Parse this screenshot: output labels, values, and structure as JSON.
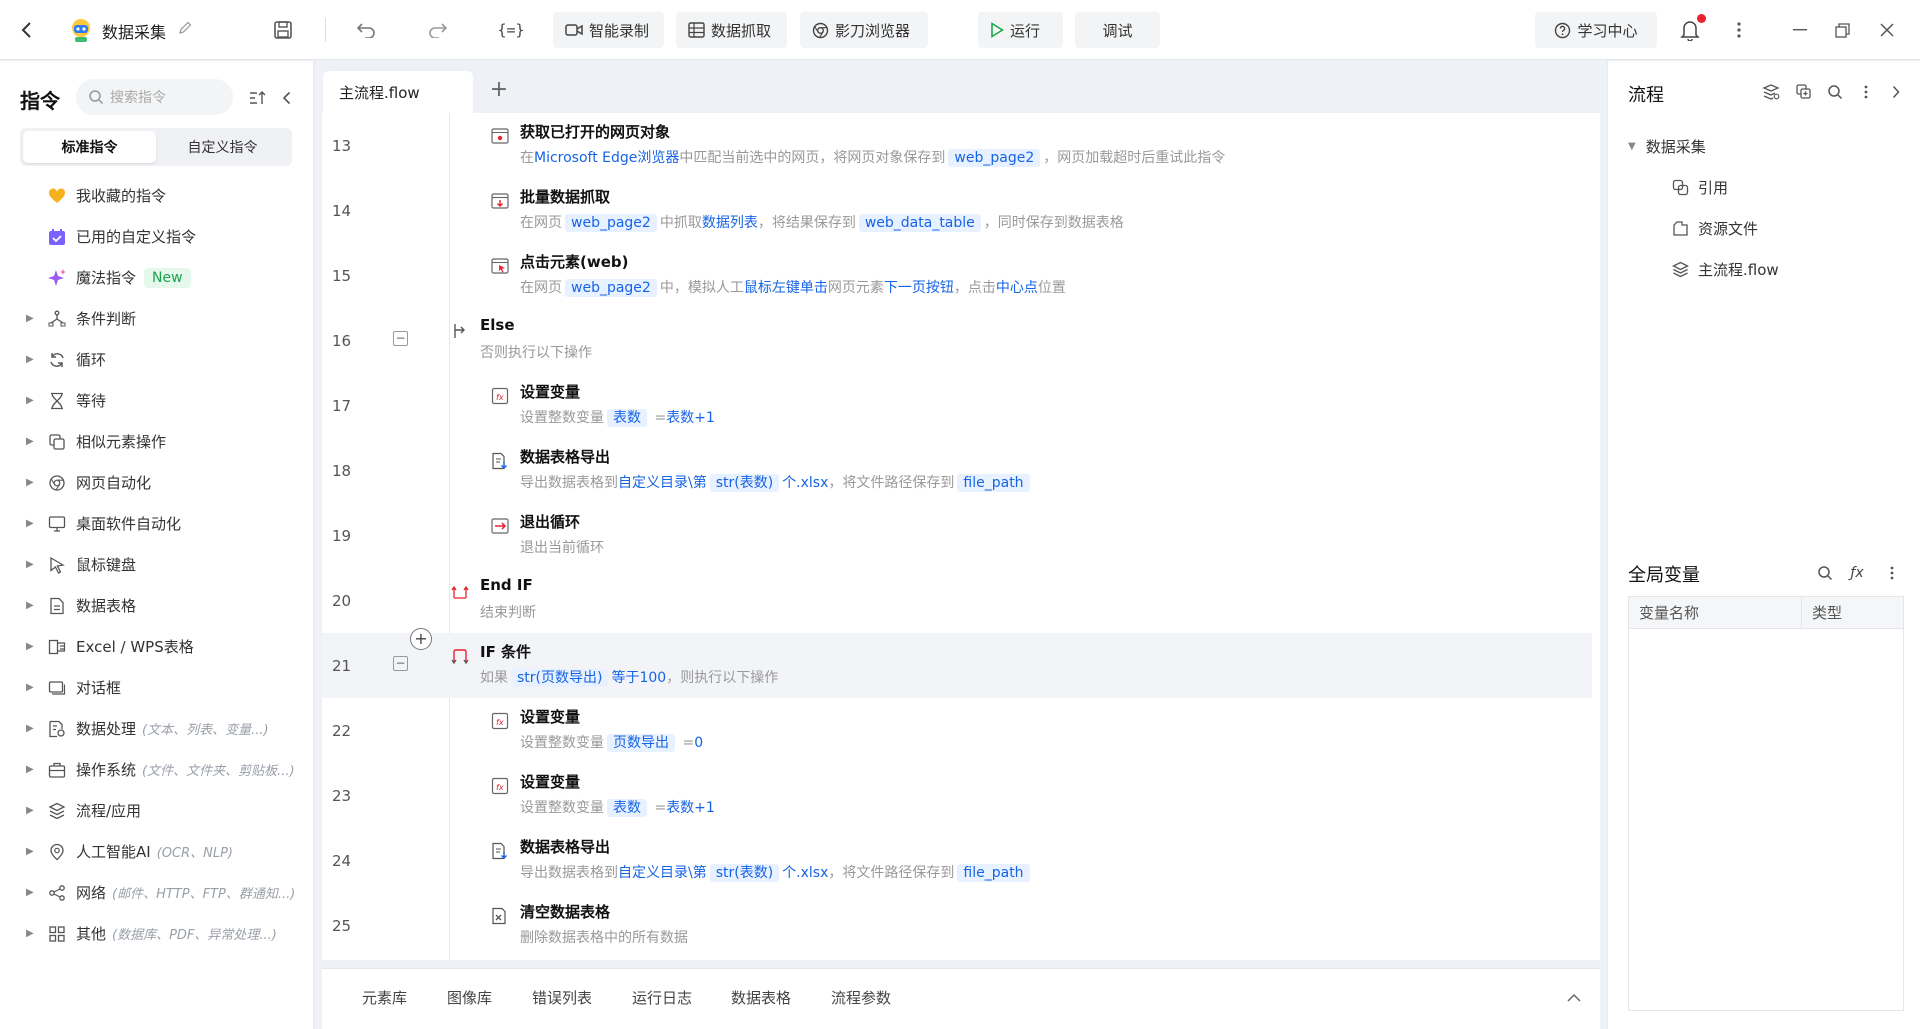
{
  "app": {
    "title": "数据采集"
  },
  "toolbar": {
    "smart_record": "智能录制",
    "data_capture": "数据抓取",
    "browser": "影刀浏览器",
    "run": "运行",
    "debug": "调试",
    "learn": "学习中心"
  },
  "left_panel": {
    "title": "指令",
    "search_placeholder": "搜索指令",
    "tabs": [
      "标准指令",
      "自定义指令"
    ],
    "favorites": "我收藏的指令",
    "used_custom": "已用的自定义指令",
    "magic": "魔法指令",
    "new_badge": "New",
    "categories": [
      {
        "label": "条件判断",
        "icon": "branch-icon",
        "sub": ""
      },
      {
        "label": "循环",
        "icon": "loop-icon",
        "sub": ""
      },
      {
        "label": "等待",
        "icon": "hourglass-icon",
        "sub": ""
      },
      {
        "label": "相似元素操作",
        "icon": "copy-icon",
        "sub": ""
      },
      {
        "label": "网页自动化",
        "icon": "browser-icon",
        "sub": ""
      },
      {
        "label": "桌面软件自动化",
        "icon": "monitor-icon",
        "sub": ""
      },
      {
        "label": "鼠标键盘",
        "icon": "cursor-icon",
        "sub": ""
      },
      {
        "label": "数据表格",
        "icon": "doc-icon",
        "sub": ""
      },
      {
        "label": "Excel / WPS表格",
        "icon": "excel-icon",
        "sub": ""
      },
      {
        "label": "对话框",
        "icon": "dialog-icon",
        "sub": ""
      },
      {
        "label": "数据处理",
        "icon": "data-process-icon",
        "sub": "(文本、列表、变量...)"
      },
      {
        "label": "操作系统",
        "icon": "toolbox-icon",
        "sub": "(文件、文件夹、剪贴板...)"
      },
      {
        "label": "流程/应用",
        "icon": "layers-icon",
        "sub": ""
      },
      {
        "label": "人工智能AI",
        "icon": "ai-icon",
        "sub": "(OCR、NLP)"
      },
      {
        "label": "网络",
        "icon": "share-icon",
        "sub": "(邮件、HTTP、FTP、群通知...)"
      },
      {
        "label": "其他",
        "icon": "grid-icon",
        "sub": "(数据库、PDF、异常处理...)"
      }
    ]
  },
  "editor": {
    "tab": "主流程.flow",
    "steps": [
      {
        "n": "13",
        "indent": 2,
        "icon": "web-object-icon",
        "title": "获取已打开的网页对象",
        "parts": [
          [
            "t",
            "在"
          ],
          [
            "k",
            "Microsoft Edge浏览器"
          ],
          [
            "t",
            "中匹配当前选中的网页，将网页对象保存到"
          ],
          [
            "v",
            "web_page2"
          ],
          [
            "t",
            "，网页加载超时后重试此指令"
          ]
        ]
      },
      {
        "n": "14",
        "indent": 2,
        "icon": "batch-capture-icon",
        "title": "批量数据抓取",
        "parts": [
          [
            "t",
            "在网页"
          ],
          [
            "v",
            "web_page2"
          ],
          [
            "t",
            "中抓取"
          ],
          [
            "k",
            "数据列表"
          ],
          [
            "t",
            "，将结果保存到"
          ],
          [
            "v",
            "web_data_table"
          ],
          [
            "t",
            "，同时保存到数据表格"
          ]
        ]
      },
      {
        "n": "15",
        "indent": 2,
        "icon": "click-element-icon",
        "title": "点击元素(web)",
        "parts": [
          [
            "t",
            "在网页"
          ],
          [
            "v",
            "web_page2"
          ],
          [
            "t",
            "中，模拟人工"
          ],
          [
            "k",
            "鼠标左键单击"
          ],
          [
            "t",
            "网页元素"
          ],
          [
            "k",
            "下一页按钮"
          ],
          [
            "t",
            "，点击"
          ],
          [
            "k",
            "中心点"
          ],
          [
            "t",
            "位置"
          ]
        ]
      },
      {
        "n": "16",
        "indent": 1,
        "icon": "else-icon",
        "title": "Else",
        "fold": true,
        "parts": [
          [
            "t",
            "否则执行以下操作"
          ]
        ]
      },
      {
        "n": "17",
        "indent": 2,
        "icon": "set-variable-icon",
        "title": "设置变量",
        "parts": [
          [
            "t",
            "设置整数变量"
          ],
          [
            "v",
            "表数"
          ],
          [
            "t",
            " ="
          ],
          [
            "k",
            "表数+1"
          ]
        ]
      },
      {
        "n": "18",
        "indent": 2,
        "icon": "table-export-icon",
        "title": "数据表格导出",
        "parts": [
          [
            "t",
            "导出数据表格到"
          ],
          [
            "k",
            "自定义目录\\第"
          ],
          [
            "v",
            "str(表数)"
          ],
          [
            "k",
            "个.xlsx"
          ],
          [
            "t",
            "，将文件路径保存到"
          ],
          [
            "v",
            "file_path"
          ]
        ]
      },
      {
        "n": "19",
        "indent": 2,
        "icon": "exit-loop-icon",
        "title": "退出循环",
        "parts": [
          [
            "t",
            "退出当前循环"
          ]
        ]
      },
      {
        "n": "20",
        "indent": 1,
        "icon": "end-if-icon",
        "title": "End IF",
        "parts": [
          [
            "t",
            "结束判断"
          ]
        ]
      },
      {
        "n": "21",
        "indent": 1,
        "icon": "if-icon",
        "title": "IF 条件",
        "fold": true,
        "highlight": true,
        "parts": [
          [
            "t",
            "如果"
          ],
          [
            "v",
            "str(页数导出)"
          ],
          [
            "k",
            "等于100"
          ],
          [
            "t",
            "，则执行以下操作"
          ]
        ]
      },
      {
        "n": "22",
        "indent": 2,
        "icon": "set-variable-icon",
        "title": "设置变量",
        "parts": [
          [
            "t",
            "设置整数变量"
          ],
          [
            "v",
            "页数导出"
          ],
          [
            "t",
            " ="
          ],
          [
            "k",
            "0"
          ]
        ]
      },
      {
        "n": "23",
        "indent": 2,
        "icon": "set-variable-icon",
        "title": "设置变量",
        "parts": [
          [
            "t",
            "设置整数变量"
          ],
          [
            "v",
            "表数"
          ],
          [
            "t",
            " ="
          ],
          [
            "k",
            "表数+1"
          ]
        ]
      },
      {
        "n": "24",
        "indent": 2,
        "icon": "table-export-icon",
        "title": "数据表格导出",
        "parts": [
          [
            "t",
            "导出数据表格到"
          ],
          [
            "k",
            "自定义目录\\第"
          ],
          [
            "v",
            "str(表数)"
          ],
          [
            "k",
            "个.xlsx"
          ],
          [
            "t",
            "，将文件路径保存到"
          ],
          [
            "v",
            "file_path"
          ]
        ]
      },
      {
        "n": "25",
        "indent": 2,
        "icon": "clear-table-icon",
        "title": "清空数据表格",
        "parts": [
          [
            "t",
            "删除数据表格中的所有数据"
          ]
        ]
      }
    ]
  },
  "bottom_tabs": [
    "元素库",
    "图像库",
    "错误列表",
    "运行日志",
    "数据表格",
    "流程参数"
  ],
  "right_panel": {
    "title": "流程",
    "root": "数据采集",
    "items": [
      {
        "label": "引用",
        "icon": "reference-icon"
      },
      {
        "label": "资源文件",
        "icon": "resource-icon"
      },
      {
        "label": "主流程.flow",
        "icon": "flow-file-icon"
      }
    ],
    "globals_title": "全局变量",
    "col_name": "变量名称",
    "col_type": "类型"
  },
  "colors": {
    "accent": "#1664e6",
    "var_bg": "#e8f1ff",
    "run_green": "#1aab4b",
    "alert_red": "#e8222f"
  }
}
